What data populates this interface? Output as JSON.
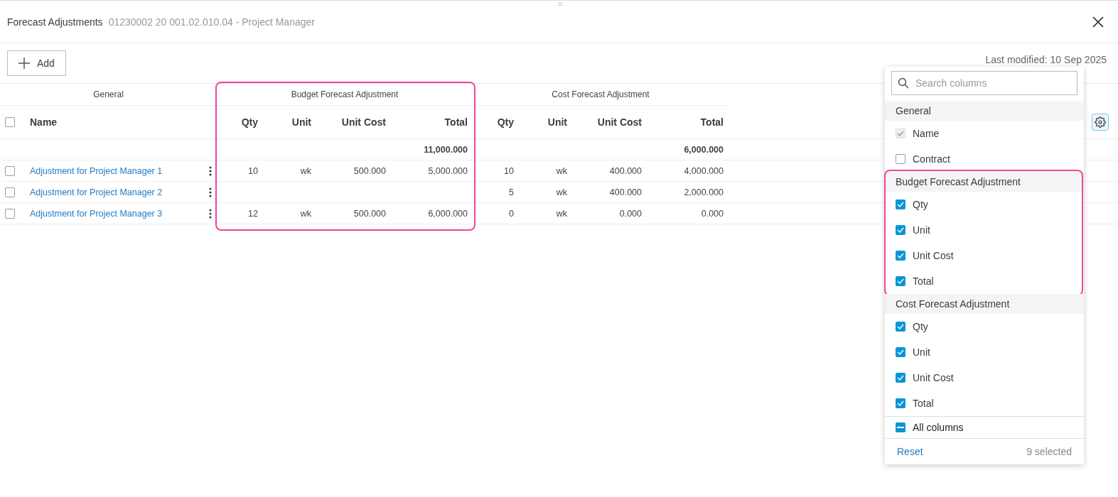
{
  "header": {
    "title": "Forecast Adjustments",
    "subtitle": "01230002 20 001.02.010.04 - Project Manager"
  },
  "toolbar": {
    "add_label": "Add",
    "last_modified": "Last modified: 10 Sep 2025"
  },
  "table": {
    "groups": [
      {
        "label": "General",
        "highlighted": false
      },
      {
        "label": "Budget Forecast Adjustment",
        "highlighted": true
      },
      {
        "label": "Cost Forecast Adjustment",
        "highlighted": false
      }
    ],
    "select_all_checked": false,
    "name_column": "Name",
    "columns": [
      "Qty",
      "Unit",
      "Unit Cost",
      "Total",
      "Qty",
      "Unit",
      "Unit Cost",
      "Total"
    ],
    "totals": [
      "11,000.000",
      "6,000.000"
    ],
    "rows": [
      {
        "name": "Adjustment for Project Manager 1",
        "checked": false,
        "cells": [
          "10",
          "wk",
          "500.000",
          "5,000.000",
          "10",
          "wk",
          "400.000",
          "4,000.000"
        ]
      },
      {
        "name": "Adjustment for Project Manager 2",
        "checked": false,
        "cells": [
          "",
          "",
          "",
          "",
          "5",
          "wk",
          "400.000",
          "2,000.000"
        ]
      },
      {
        "name": "Adjustment for Project Manager 3",
        "checked": false,
        "cells": [
          "12",
          "wk",
          "500.000",
          "6,000.000",
          "0",
          "wk",
          "0.000",
          "0.000"
        ]
      }
    ]
  },
  "column_picker": {
    "search_placeholder": "Search columns",
    "sections": [
      {
        "title": "General",
        "highlighted": false,
        "items": [
          {
            "label": "Name",
            "checked": true,
            "disabled": true
          },
          {
            "label": "Contract",
            "checked": false,
            "disabled": false
          }
        ]
      },
      {
        "title": "Budget Forecast Adjustment",
        "highlighted": true,
        "items": [
          {
            "label": "Qty",
            "checked": true,
            "disabled": false
          },
          {
            "label": "Unit",
            "checked": true,
            "disabled": false
          },
          {
            "label": "Unit Cost",
            "checked": true,
            "disabled": false
          },
          {
            "label": "Total",
            "checked": true,
            "disabled": false
          }
        ]
      },
      {
        "title": "Cost Forecast Adjustment",
        "highlighted": false,
        "items": [
          {
            "label": "Qty",
            "checked": true,
            "disabled": false
          },
          {
            "label": "Unit",
            "checked": true,
            "disabled": false
          },
          {
            "label": "Unit Cost",
            "checked": true,
            "disabled": false
          },
          {
            "label": "Total",
            "checked": true,
            "disabled": false
          }
        ]
      }
    ],
    "all_columns": {
      "label": "All columns",
      "indeterminate": true
    },
    "reset": "Reset",
    "selected_count": "9 selected"
  }
}
